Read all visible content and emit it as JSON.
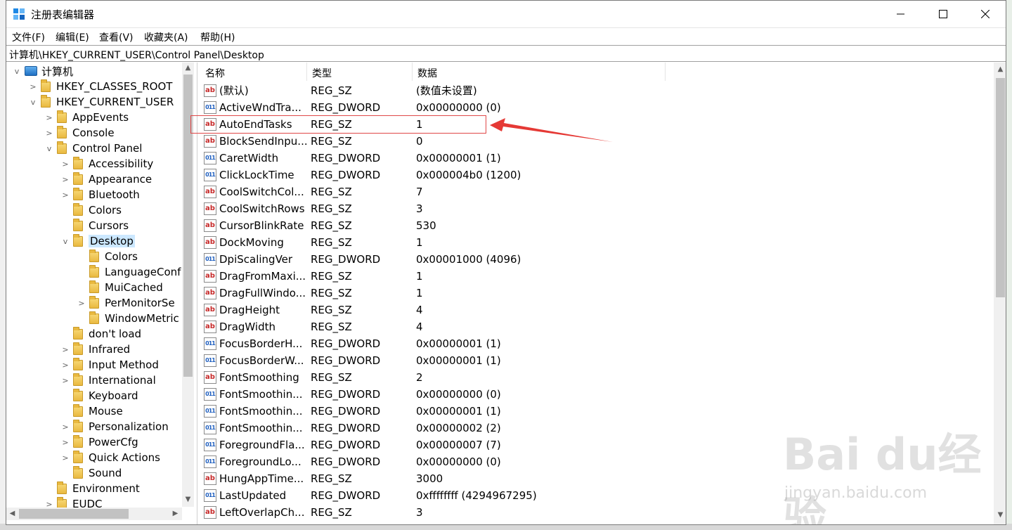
{
  "window": {
    "title": "注册表编辑器"
  },
  "menu": [
    "文件(F)",
    "编辑(E)",
    "查看(V)",
    "收藏夹(A)",
    "帮助(H)"
  ],
  "address": "计算机\\HKEY_CURRENT_USER\\Control Panel\\Desktop",
  "tree": [
    {
      "label": "计算机",
      "depth": 0,
      "exp": "v",
      "icon": "computer-icon"
    },
    {
      "label": "HKEY_CLASSES_ROOT",
      "depth": 1,
      "exp": ">"
    },
    {
      "label": "HKEY_CURRENT_USER",
      "depth": 1,
      "exp": "v"
    },
    {
      "label": "AppEvents",
      "depth": 2,
      "exp": ">"
    },
    {
      "label": "Console",
      "depth": 2,
      "exp": ">"
    },
    {
      "label": "Control Panel",
      "depth": 2,
      "exp": "v"
    },
    {
      "label": "Accessibility",
      "depth": 3,
      "exp": ">"
    },
    {
      "label": "Appearance",
      "depth": 3,
      "exp": ">"
    },
    {
      "label": "Bluetooth",
      "depth": 3,
      "exp": ">"
    },
    {
      "label": "Colors",
      "depth": 3,
      "exp": ""
    },
    {
      "label": "Cursors",
      "depth": 3,
      "exp": ""
    },
    {
      "label": "Desktop",
      "depth": 3,
      "exp": "v",
      "selected": true
    },
    {
      "label": "Colors",
      "depth": 4,
      "exp": ""
    },
    {
      "label": "LanguageConf",
      "depth": 4,
      "exp": ""
    },
    {
      "label": "MuiCached",
      "depth": 4,
      "exp": ""
    },
    {
      "label": "PerMonitorSe",
      "depth": 4,
      "exp": ">"
    },
    {
      "label": "WindowMetric",
      "depth": 4,
      "exp": ""
    },
    {
      "label": "don't load",
      "depth": 3,
      "exp": ""
    },
    {
      "label": "Infrared",
      "depth": 3,
      "exp": ">"
    },
    {
      "label": "Input Method",
      "depth": 3,
      "exp": ">"
    },
    {
      "label": "International",
      "depth": 3,
      "exp": ">"
    },
    {
      "label": "Keyboard",
      "depth": 3,
      "exp": ""
    },
    {
      "label": "Mouse",
      "depth": 3,
      "exp": ""
    },
    {
      "label": "Personalization",
      "depth": 3,
      "exp": ">"
    },
    {
      "label": "PowerCfg",
      "depth": 3,
      "exp": ">"
    },
    {
      "label": "Quick Actions",
      "depth": 3,
      "exp": ">"
    },
    {
      "label": "Sound",
      "depth": 3,
      "exp": ""
    },
    {
      "label": "Environment",
      "depth": 2,
      "exp": ""
    },
    {
      "label": "EUDC",
      "depth": 2,
      "exp": ">"
    }
  ],
  "columns": {
    "name": "名称",
    "type": "类型",
    "data": "数据"
  },
  "values": [
    {
      "name": "(默认)",
      "type": "REG_SZ",
      "data": "(数值未设置)",
      "icon": "sz"
    },
    {
      "name": "ActiveWndTra...",
      "type": "REG_DWORD",
      "data": "0x00000000 (0)",
      "icon": "dw"
    },
    {
      "name": "AutoEndTasks",
      "type": "REG_SZ",
      "data": "1",
      "icon": "sz"
    },
    {
      "name": "BlockSendInpu...",
      "type": "REG_SZ",
      "data": "0",
      "icon": "sz"
    },
    {
      "name": "CaretWidth",
      "type": "REG_DWORD",
      "data": "0x00000001 (1)",
      "icon": "dw"
    },
    {
      "name": "ClickLockTime",
      "type": "REG_DWORD",
      "data": "0x000004b0 (1200)",
      "icon": "dw"
    },
    {
      "name": "CoolSwitchCol...",
      "type": "REG_SZ",
      "data": "7",
      "icon": "sz"
    },
    {
      "name": "CoolSwitchRows",
      "type": "REG_SZ",
      "data": "3",
      "icon": "sz"
    },
    {
      "name": "CursorBlinkRate",
      "type": "REG_SZ",
      "data": "530",
      "icon": "sz"
    },
    {
      "name": "DockMoving",
      "type": "REG_SZ",
      "data": "1",
      "icon": "sz"
    },
    {
      "name": "DpiScalingVer",
      "type": "REG_DWORD",
      "data": "0x00001000 (4096)",
      "icon": "dw"
    },
    {
      "name": "DragFromMaxi...",
      "type": "REG_SZ",
      "data": "1",
      "icon": "sz"
    },
    {
      "name": "DragFullWindo...",
      "type": "REG_SZ",
      "data": "1",
      "icon": "sz"
    },
    {
      "name": "DragHeight",
      "type": "REG_SZ",
      "data": "4",
      "icon": "sz"
    },
    {
      "name": "DragWidth",
      "type": "REG_SZ",
      "data": "4",
      "icon": "sz"
    },
    {
      "name": "FocusBorderH...",
      "type": "REG_DWORD",
      "data": "0x00000001 (1)",
      "icon": "dw"
    },
    {
      "name": "FocusBorderW...",
      "type": "REG_DWORD",
      "data": "0x00000001 (1)",
      "icon": "dw"
    },
    {
      "name": "FontSmoothing",
      "type": "REG_SZ",
      "data": "2",
      "icon": "sz"
    },
    {
      "name": "FontSmoothin...",
      "type": "REG_DWORD",
      "data": "0x00000000 (0)",
      "icon": "dw"
    },
    {
      "name": "FontSmoothin...",
      "type": "REG_DWORD",
      "data": "0x00000001 (1)",
      "icon": "dw"
    },
    {
      "name": "FontSmoothin...",
      "type": "REG_DWORD",
      "data": "0x00000002 (2)",
      "icon": "dw"
    },
    {
      "name": "ForegroundFla...",
      "type": "REG_DWORD",
      "data": "0x00000007 (7)",
      "icon": "dw"
    },
    {
      "name": "ForegroundLo...",
      "type": "REG_DWORD",
      "data": "0x00000000 (0)",
      "icon": "dw"
    },
    {
      "name": "HungAppTime...",
      "type": "REG_SZ",
      "data": "3000",
      "icon": "sz"
    },
    {
      "name": "LastUpdated",
      "type": "REG_DWORD",
      "data": "0xffffffff (4294967295)",
      "icon": "dw"
    },
    {
      "name": "LeftOverlapCh...",
      "type": "REG_SZ",
      "data": "3",
      "icon": "sz"
    }
  ],
  "icons": {
    "sz": "ab",
    "dw": "011"
  },
  "watermark": {
    "main": "Bai du经验",
    "sub": "jingyan.baidu.com"
  },
  "colors": {
    "highlight": "#e04848",
    "selection": "#cce8ff"
  }
}
